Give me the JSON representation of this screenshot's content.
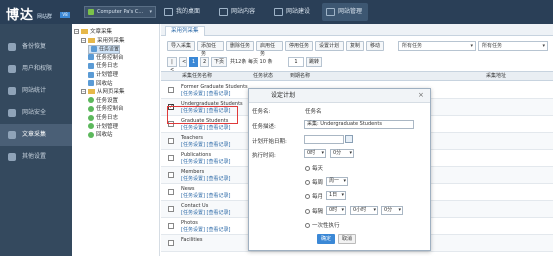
{
  "header": {
    "logo": "博达",
    "logo_sub": "网站群",
    "logo_badge": "V8",
    "site_select": "Computer Pa's C...",
    "nav": [
      {
        "label": "我的桌面"
      },
      {
        "label": "网站内容"
      },
      {
        "label": "网站建设"
      },
      {
        "label": "网站管理"
      }
    ]
  },
  "sidebar": {
    "items": [
      {
        "label": "备份恢复"
      },
      {
        "label": "用户和权限"
      },
      {
        "label": "网站统计"
      },
      {
        "label": "网站安全"
      },
      {
        "label": "文章采集"
      },
      {
        "label": "其他设置"
      }
    ]
  },
  "tree": {
    "rows": [
      {
        "label": "文章采集",
        "indent": 0,
        "kind": "box",
        "mark": "−"
      },
      {
        "label": "采用列采集",
        "indent": 1,
        "kind": "box",
        "mark": "−"
      },
      {
        "label": "任务设置",
        "indent": 2,
        "kind": "leaf",
        "selected": true
      },
      {
        "label": "任务控制台",
        "indent": 2,
        "kind": "leaf"
      },
      {
        "label": "任务日志",
        "indent": 2,
        "kind": "leaf"
      },
      {
        "label": "计划管理",
        "indent": 2,
        "kind": "leaf"
      },
      {
        "label": "回收站",
        "indent": 2,
        "kind": "leaf"
      },
      {
        "label": "从网页采集",
        "indent": 1,
        "kind": "box",
        "mark": "−"
      },
      {
        "label": "任务设置",
        "indent": 2,
        "kind": "grn"
      },
      {
        "label": "任务控制台",
        "indent": 2,
        "kind": "grn"
      },
      {
        "label": "任务日志",
        "indent": 2,
        "kind": "grn"
      },
      {
        "label": "计划管理",
        "indent": 2,
        "kind": "grn"
      },
      {
        "label": "回收站",
        "indent": 2,
        "kind": "grn"
      }
    ]
  },
  "main": {
    "tab": "采用列采集",
    "toolbar": [
      "导入采集",
      "添加任务",
      "删除任务",
      "启用任务",
      "停用任务",
      "设置计划",
      "复制",
      "移动",
      "批量清空采集记录"
    ],
    "filter1": "所有任务",
    "filter2": "所有任务",
    "pager": {
      "first": "|<",
      "prev": "<",
      "page": "1",
      "page2": "2",
      "next": "下页",
      "summary": "共12条 每页 10 条",
      "goto": "1",
      "go_label": "跳转"
    },
    "columns": [
      "采集任务名称",
      "任务状态",
      "到期名称",
      "采集地址"
    ],
    "rows": [
      {
        "name": "Former Graduate Students",
        "links": "[任务设置] [查看记录]",
        "checked": false
      },
      {
        "name": "Undergraduate Students",
        "links": "[任务设置] [查看记录]",
        "checked": true
      },
      {
        "name": "Graduate Students",
        "links": "[任务设置] [查看记录]",
        "checked": false
      },
      {
        "name": "Teachers",
        "links": "[任务设置] [查看记录]",
        "checked": false
      },
      {
        "name": "Publications",
        "links": "[任务设置] [查看记录]",
        "checked": false
      },
      {
        "name": "Members",
        "links": "[任务设置] [查看记录]",
        "checked": false
      },
      {
        "name": "News",
        "links": "[任务设置] [查看记录]",
        "checked": false
      },
      {
        "name": "Contact Us",
        "links": "[任务设置] [查看记录]",
        "checked": false
      },
      {
        "name": "Photos",
        "links": "[任务设置] [查看记录]",
        "checked": false
      },
      {
        "name": "Facilities",
        "links": "",
        "checked": false
      }
    ]
  },
  "modal": {
    "title": "设定计划",
    "close": "×",
    "task_name_label": "任务名:",
    "task_name_value": "任务名",
    "task_desc_label": "任务描述:",
    "task_desc_value": "采集: Undergraduate  Students",
    "start_date_label": "计划开始日期:",
    "start_date_value": "",
    "exec_time_label": "执行时间:",
    "hour": "0时",
    "minute": "0分",
    "opt_daily": "每天",
    "opt_weekly": "每周",
    "weekday": "周一",
    "opt_monthly": "每月",
    "monthday": "1日",
    "opt_every": "每隔",
    "every_hour": "0小时",
    "every_min": "0分",
    "opt_once": "一次性执行",
    "ok": "确定",
    "cancel": "取消"
  }
}
